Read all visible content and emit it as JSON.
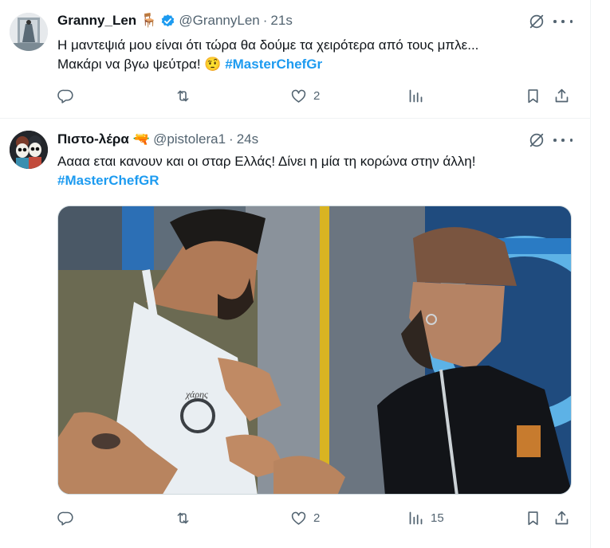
{
  "tweets": [
    {
      "display_name": "Granny_Len",
      "name_emoji": "🪑",
      "verified": true,
      "handle": "@GrannyLen",
      "separator": "·",
      "time": "21s",
      "text_line1": "Η μαντεψιά μου είναι ότι τώρα θα δούμε τα χειρότερα από τους μπλε...",
      "text_line2": "Μακάρι να βγω ψεύτρα!",
      "text_emoji": "🤨",
      "hashtag": "#MasterChefGr",
      "actions": {
        "reply": "",
        "retweet": "",
        "like": "2",
        "views": "",
        "bookmark": "",
        "share": ""
      }
    },
    {
      "display_name": "Πιστο-λέρα",
      "name_emoji": "🔫",
      "verified": false,
      "handle": "@pistolera1",
      "separator": "·",
      "time": "24s",
      "text_line1": "Αααα εται κανουν και οι σταρ Ελλάς! Δίνει η μία τη κορώνα στην άλλη!",
      "hashtag": "#MasterChefGR",
      "media_caption": "χάρης",
      "actions": {
        "reply": "",
        "retweet": "",
        "like": "2",
        "views": "15",
        "bookmark": "",
        "share": ""
      }
    }
  ],
  "colors": {
    "accent": "#1d9bf0",
    "muted": "#536471",
    "text": "#0f1419",
    "border": "#eff3f4"
  }
}
